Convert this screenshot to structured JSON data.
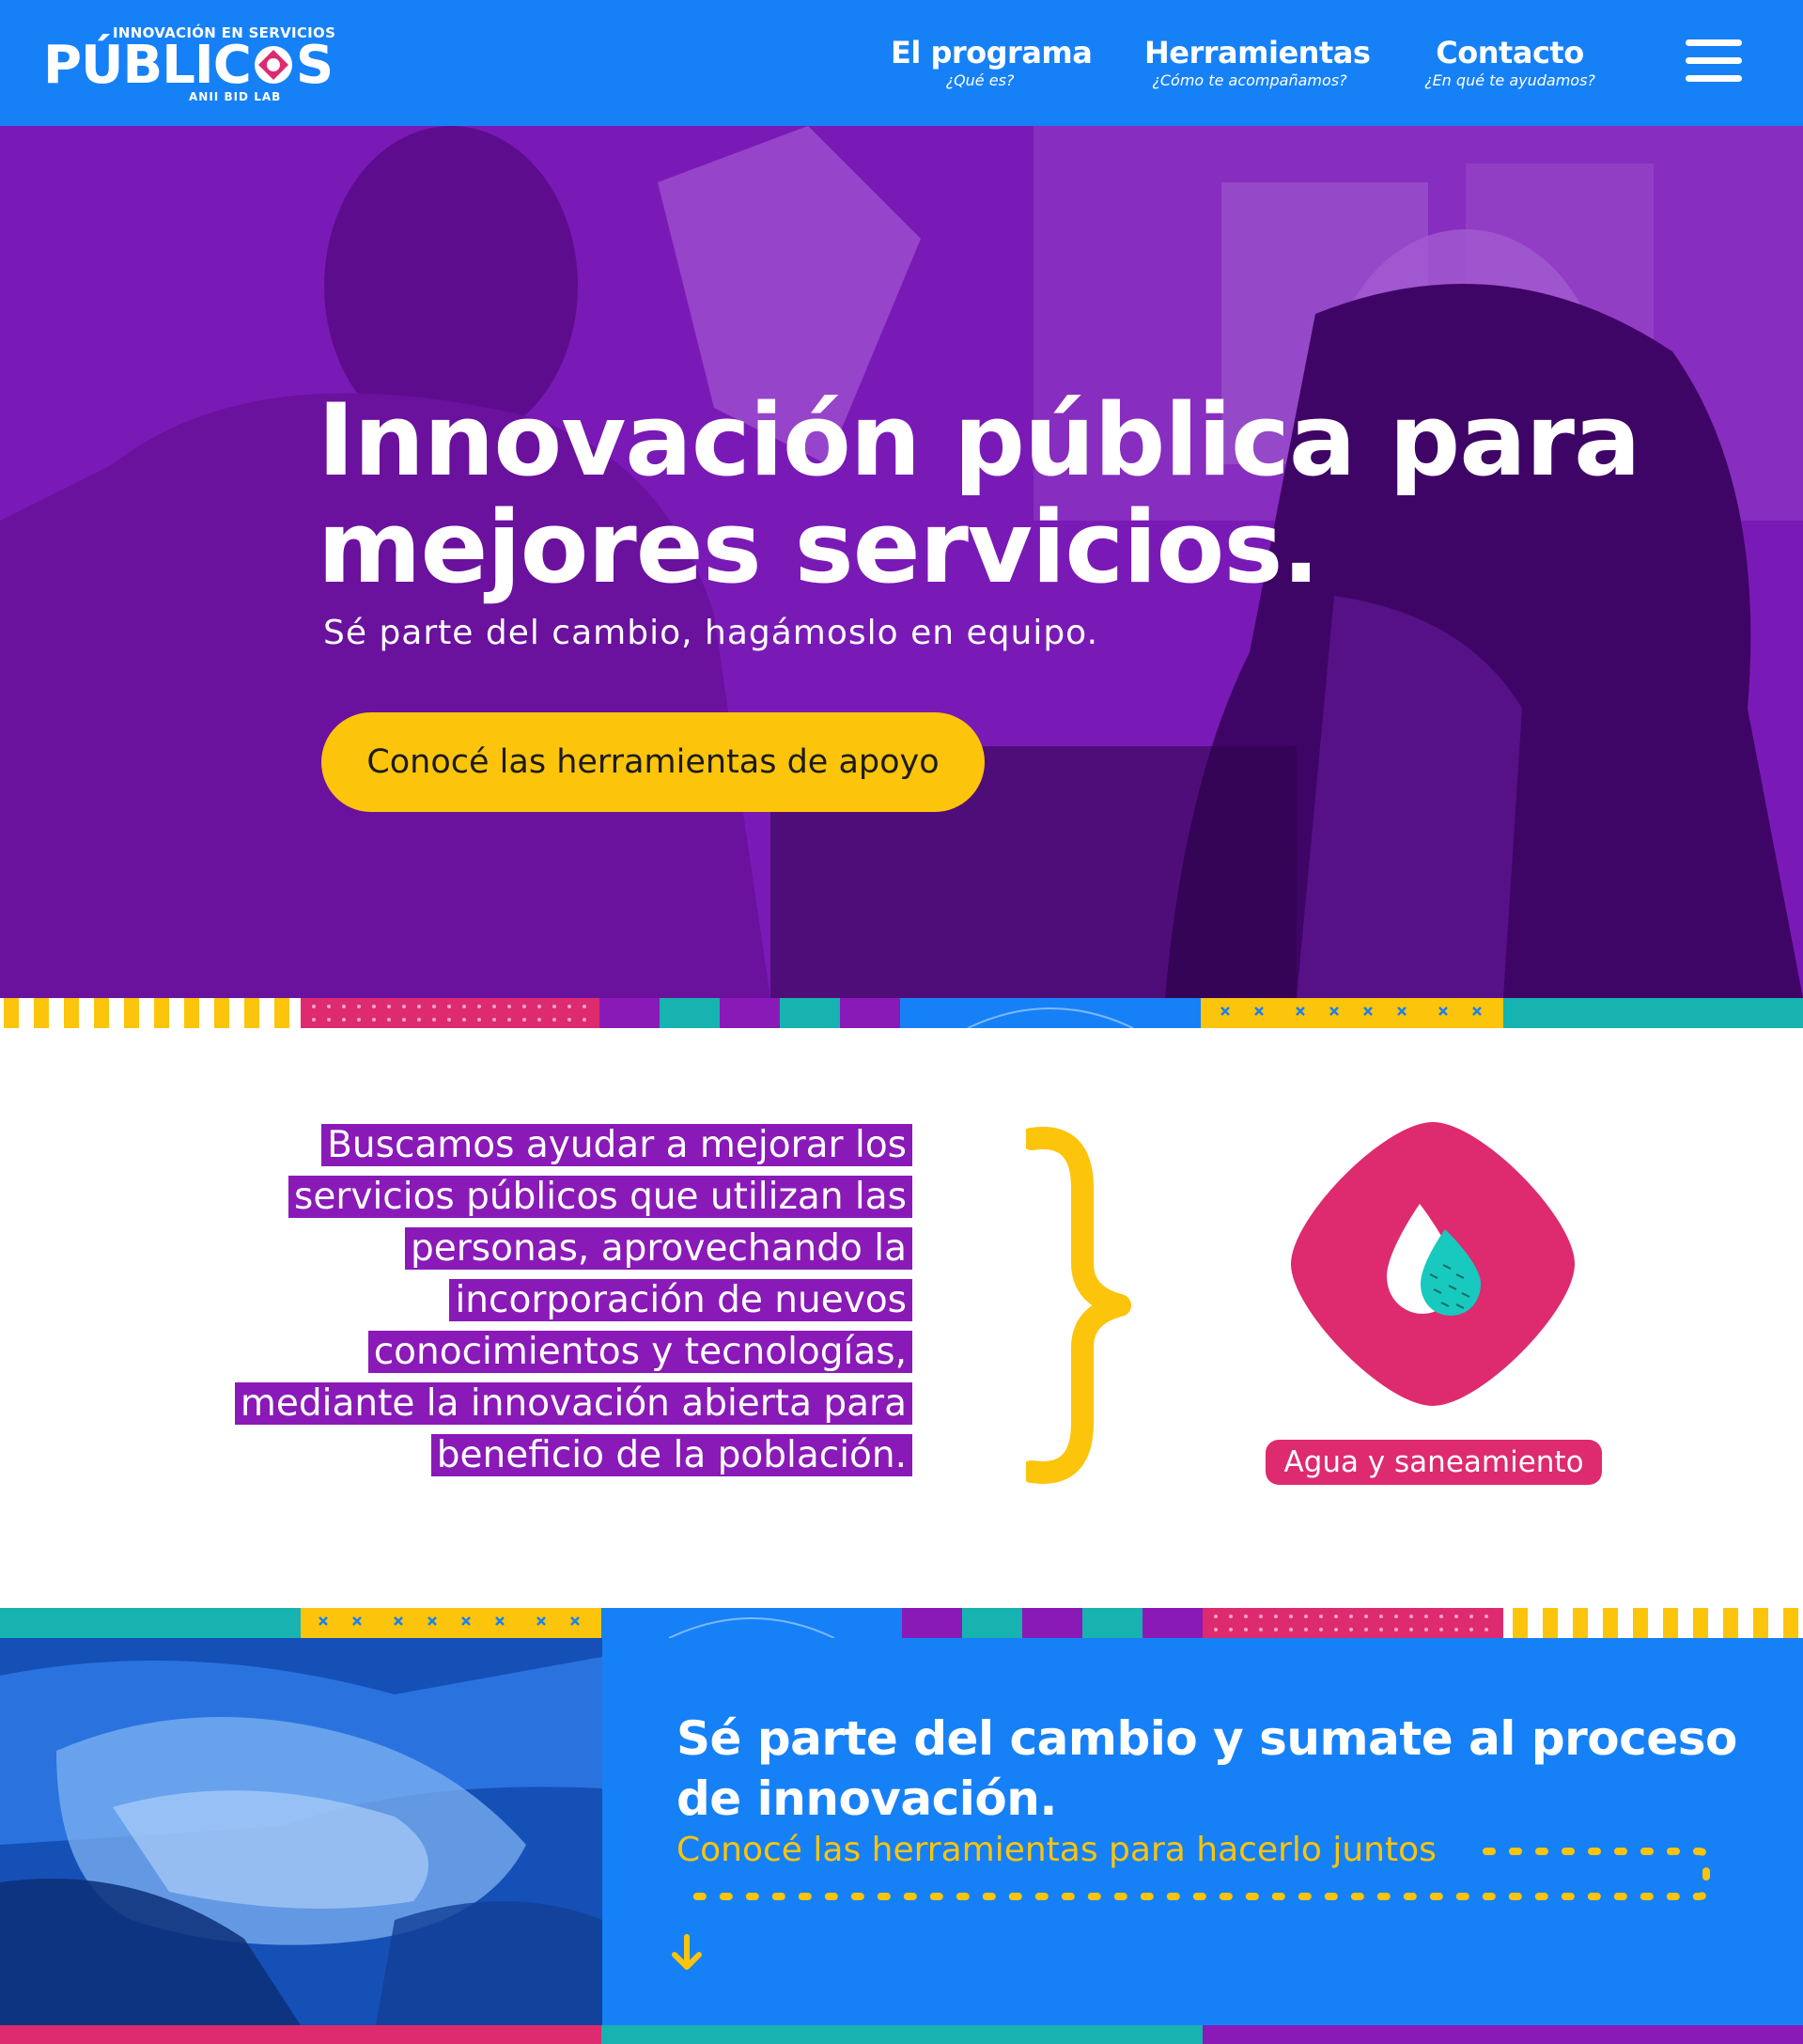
{
  "header": {
    "logo": {
      "top": "INNOVACIÓN EN SERVICIOS",
      "main_left": "PÚBLIC",
      "main_right": "S",
      "bottom": "ANII BID LAB"
    },
    "nav": [
      {
        "title": "El programa",
        "sub": "¿Qué es?"
      },
      {
        "title": "Herramientas",
        "sub": "¿Cómo te acompañamos?"
      },
      {
        "title": "Contacto",
        "sub": "¿En qué te ayudamos?"
      }
    ],
    "menu_icon": "hamburger-menu-icon"
  },
  "hero": {
    "title_line1": "Innovación pública para",
    "title_line2": "mejores servicios.",
    "subtitle": "Sé parte del cambio, hagámoslo en equipo.",
    "cta": "Conocé las herramientas de apoyo"
  },
  "mission": {
    "lines": [
      "Buscamos ayudar a mejorar los",
      "servicios públicos que utilizan las",
      "personas, aprovechando la",
      "incorporación de nuevos",
      "conocimientos y tecnologías,",
      "mediante la innovación abierta para",
      "beneficio de la población."
    ],
    "badge_icon": "water-drop-icon",
    "badge_label": "Agua y saneamiento"
  },
  "bottom": {
    "title": "Sé parte del cambio y sumate al proceso de innovación.",
    "subtitle": "Conocé las herramientas para hacerlo juntos",
    "arrow_icon": "arrow-down-icon"
  },
  "colors": {
    "blue": "#1681f7",
    "purple": "#8a1ab8",
    "yellow": "#fcc40a",
    "pink": "#de2a6e",
    "teal": "#17b3b0"
  }
}
